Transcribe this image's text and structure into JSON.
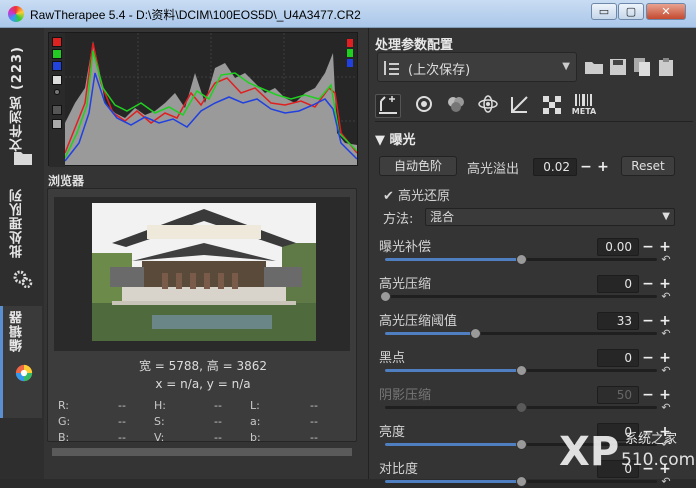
{
  "window": {
    "title": "RawTherapee 5.4 - D:\\资料\\DCIM\\100EOS5D\\_U4A3477.CR2",
    "minimize": "▭",
    "maximize": "▢",
    "close": "✕"
  },
  "left_tabs": {
    "file_browser": "文件浏览 (223)",
    "batch_queue": "批处理队列",
    "editor": "编辑器"
  },
  "histogram": {
    "channels": [
      "red",
      "green",
      "blue",
      "luminance",
      "chroma",
      "raw"
    ]
  },
  "browser": {
    "label": "浏览器",
    "dims": "宽 = 5788, 高 = 3862",
    "coords": "x = n/a, y = n/a",
    "pixel_info": [
      [
        "R:",
        "--",
        "H:",
        "--",
        "L:",
        "--"
      ],
      [
        "G:",
        "--",
        "S:",
        "--",
        "a:",
        "--"
      ],
      [
        "B:",
        "--",
        "V:",
        "--",
        "b:",
        "--"
      ]
    ]
  },
  "right_panel": {
    "title": "处理参数配置",
    "profile": "(上次保存)",
    "tool_tabs": [
      "exposure-tab",
      "detail-tab",
      "color-tab",
      "advanced-tab",
      "transform-tab",
      "raw-tab",
      "metadata-tab"
    ],
    "metadata_tab": "META",
    "exposure_header": "曝光",
    "auto_levels": "自动色阶",
    "highlight_clip_label": "高光溢出",
    "highlight_clip_value": "0.02",
    "reset": "Reset",
    "hl_reconstruct": "高光还原",
    "method_label": "方法:",
    "method_value": "混合",
    "sliders": [
      {
        "label": "曝光补偿",
        "value": "0.00",
        "frac": 0.5,
        "dim": false
      },
      {
        "label": "高光压缩",
        "value": "0",
        "frac": 0.0,
        "dim": false
      },
      {
        "label": "高光压缩阈值",
        "value": "33",
        "frac": 0.33,
        "dim": false
      },
      {
        "label": "黑点",
        "value": "0",
        "frac": 0.5,
        "dim": false
      },
      {
        "label": "阴影压缩",
        "value": "50",
        "frac": 0.5,
        "dim": true
      },
      {
        "label": "亮度",
        "value": "0",
        "frac": 0.5,
        "dim": false
      },
      {
        "label": "对比度",
        "value": "0",
        "frac": 0.5,
        "dim": false
      }
    ]
  },
  "watermark": {
    "text": "XP系统之家",
    "site": "510.com"
  },
  "colors": {
    "accent": "#4f7fc0",
    "panel": "#343434",
    "titlebar": "#bcd3ee"
  }
}
